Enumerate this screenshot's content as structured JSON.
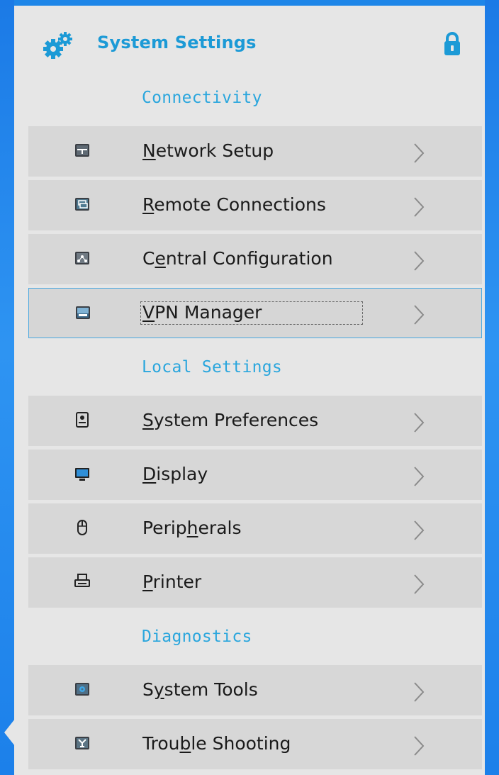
{
  "header": {
    "title": "System Settings",
    "icon": "gears-icon",
    "lock_icon": "lock-icon",
    "accent_color": "#1c9ad6"
  },
  "sections": [
    {
      "title": "Connectivity",
      "items": [
        {
          "id": "network-setup",
          "pre": "",
          "mn": "N",
          "post": "etwork Setup",
          "icon": "network-icon"
        },
        {
          "id": "remote-connections",
          "pre": "",
          "mn": "R",
          "post": "emote Connections",
          "icon": "remote-connections-icon"
        },
        {
          "id": "central-configuration",
          "pre": "C",
          "mn": "e",
          "post": "ntral Configuration",
          "icon": "central-configuration-icon"
        },
        {
          "id": "vpn-manager",
          "pre": "",
          "mn": "V",
          "post": "PN Manager",
          "icon": "vpn-icon",
          "selected": true
        }
      ]
    },
    {
      "title": "Local Settings",
      "items": [
        {
          "id": "system-preferences",
          "pre": "",
          "mn": "S",
          "post": "ystem Preferences",
          "icon": "system-preferences-icon"
        },
        {
          "id": "display",
          "pre": "",
          "mn": "D",
          "post": "isplay",
          "icon": "monitor-icon"
        },
        {
          "id": "peripherals",
          "pre": "Perip",
          "mn": "h",
          "post": "erals",
          "icon": "mouse-icon"
        },
        {
          "id": "printer",
          "pre": "",
          "mn": "P",
          "post": "rinter",
          "icon": "printer-icon"
        }
      ]
    },
    {
      "title": "Diagnostics",
      "items": [
        {
          "id": "system-tools",
          "pre": "S",
          "mn": "y",
          "post": "stem Tools",
          "icon": "system-tools-icon"
        },
        {
          "id": "trouble-shooting",
          "pre": "Trou",
          "mn": "b",
          "post": "le Shooting",
          "icon": "trouble-shooting-icon"
        }
      ]
    }
  ]
}
